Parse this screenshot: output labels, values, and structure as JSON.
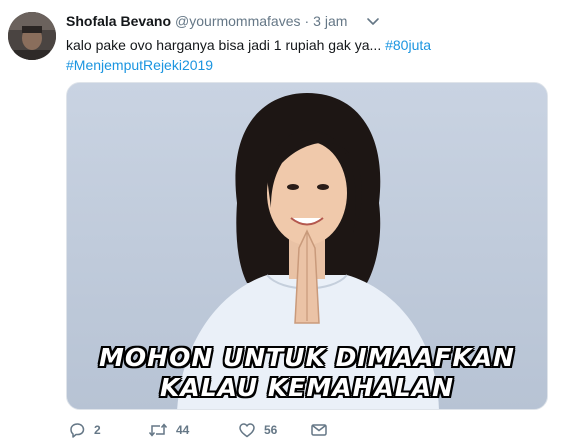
{
  "tweet": {
    "author_name": "Shofala Bevano",
    "handle": "@yourmommafaves",
    "separator": "·",
    "time": "3 jam",
    "text": "kalo pake ovo harganya bisa jadi 1 rupiah gak ya...",
    "hashtag_inline": "#80juta",
    "hashtag_line": "#MenjemputRejeki2019",
    "media": {
      "caption_line1": "MOHON UNTUK DIMAAFKAN",
      "caption_line2": "KALAU KEMAHALAN"
    },
    "actions": {
      "reply_count": "2",
      "retweet_count": "44",
      "like_count": "56"
    },
    "icons": [
      "avatar",
      "chevron-down-icon",
      "reply-icon",
      "retweet-icon",
      "like-icon",
      "direct-message-icon"
    ],
    "colors": {
      "link": "#1b95e0",
      "muted": "#657786",
      "text": "#14171a"
    }
  }
}
